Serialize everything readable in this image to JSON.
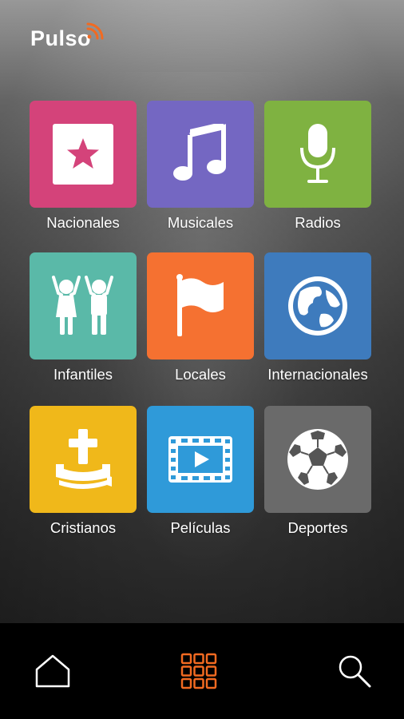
{
  "app": {
    "logo_text": "Pulso"
  },
  "colors": {
    "nacionales": "#d4437a",
    "musicales": "#7467c2",
    "radios": "#7fb241",
    "infantiles": "#5ab9a8",
    "locales": "#f57131",
    "internacionales": "#3e7bbd",
    "cristianos": "#f0b81a",
    "peliculas": "#2f9ad9",
    "deportes": "#6a6a6a",
    "nav_active": "#f26a21",
    "nav_inactive": "#ffffff"
  },
  "categories": [
    {
      "label": "Nacionales",
      "icon": "star-icon"
    },
    {
      "label": "Musicales",
      "icon": "music-note-icon"
    },
    {
      "label": "Radios",
      "icon": "microphone-icon"
    },
    {
      "label": "Infantiles",
      "icon": "children-icon"
    },
    {
      "label": "Locales",
      "icon": "flag-icon"
    },
    {
      "label": "Internacionales",
      "icon": "globe-icon"
    },
    {
      "label": "Cristianos",
      "icon": "bible-cross-icon"
    },
    {
      "label": "Películas",
      "icon": "film-play-icon"
    },
    {
      "label": "Deportes",
      "icon": "soccer-ball-icon"
    }
  ],
  "bottom_nav": [
    {
      "icon": "home-icon",
      "active": false
    },
    {
      "icon": "grid-icon",
      "active": true
    },
    {
      "icon": "search-icon",
      "active": false
    }
  ]
}
